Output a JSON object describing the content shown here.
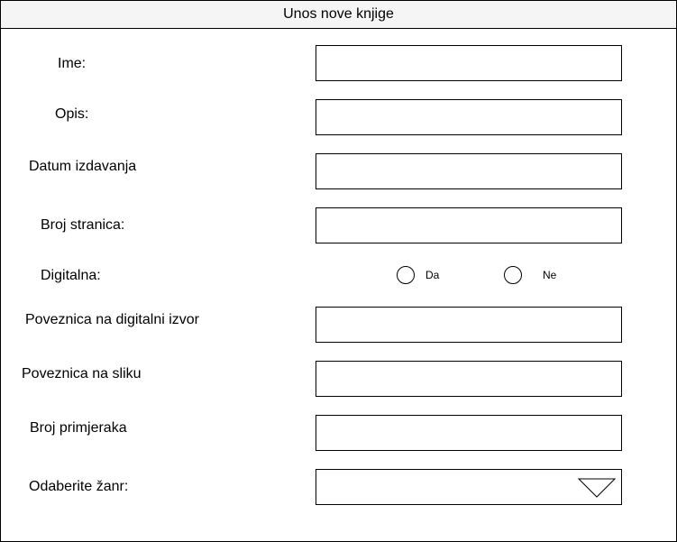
{
  "window": {
    "title": "Unos nove knjige"
  },
  "form": {
    "name_label": "Ime:",
    "name_value": "",
    "description_label": "Opis:",
    "description_value": "",
    "publish_date_label": "Datum izdavanja",
    "publish_date_value": "",
    "page_count_label": "Broj stranica:",
    "page_count_value": "",
    "digital_label": "Digitalna:",
    "digital_yes_label": "Da",
    "digital_no_label": "Ne",
    "digital_link_label": "Poveznica na digitalni izvor",
    "digital_link_value": "",
    "image_link_label": "Poveznica na sliku",
    "image_link_value": "",
    "copies_label": "Broj primjeraka",
    "copies_value": "",
    "genre_label": "Odaberite žanr:",
    "genre_selected": ""
  },
  "icons": {
    "genre_dropdown": "triangle-down-icon"
  }
}
